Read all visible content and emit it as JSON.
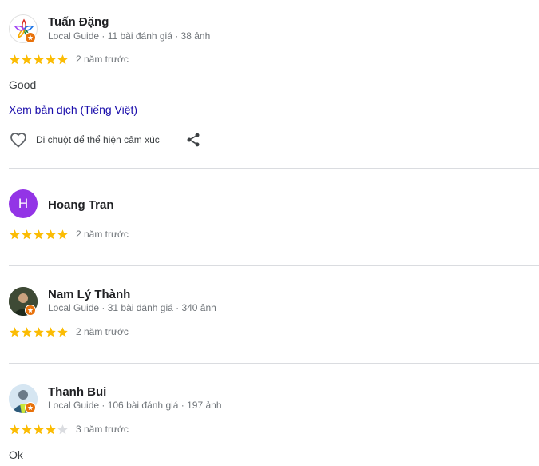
{
  "colors": {
    "star_filled": "#fbbc04",
    "star_empty": "#dadce0",
    "link": "#1a0dab",
    "meta": "#70757a",
    "local_guide_badge": "#e8710a",
    "avatar_h": "#9334e6"
  },
  "reviews": [
    {
      "name": "Tuấn Đặng",
      "meta": "Local Guide · 11 bài đánh giá · 38 ảnh",
      "avatar_icon": "flower-logo-avatar",
      "rating": 5,
      "time": "2 năm trước",
      "text": "Good",
      "translate": "Xem bản dịch (Tiếng Việt)",
      "react_label": "Di chuột để thể hiện cảm xúc"
    },
    {
      "name": "Hoang Tran",
      "avatar_letter": "H",
      "rating": 5,
      "time": "2 năm trước"
    },
    {
      "name": "Nam Lý Thành",
      "meta": "Local Guide · 31 bài đánh giá · 340 ảnh",
      "avatar_icon": "photo-avatar",
      "rating": 5,
      "time": "2 năm trước"
    },
    {
      "name": "Thanh Bui",
      "meta": "Local Guide · 106 bài đánh giá · 197 ảnh",
      "avatar_icon": "photo-avatar",
      "rating": 4,
      "time": "3 năm trước",
      "text": "Ok"
    }
  ]
}
